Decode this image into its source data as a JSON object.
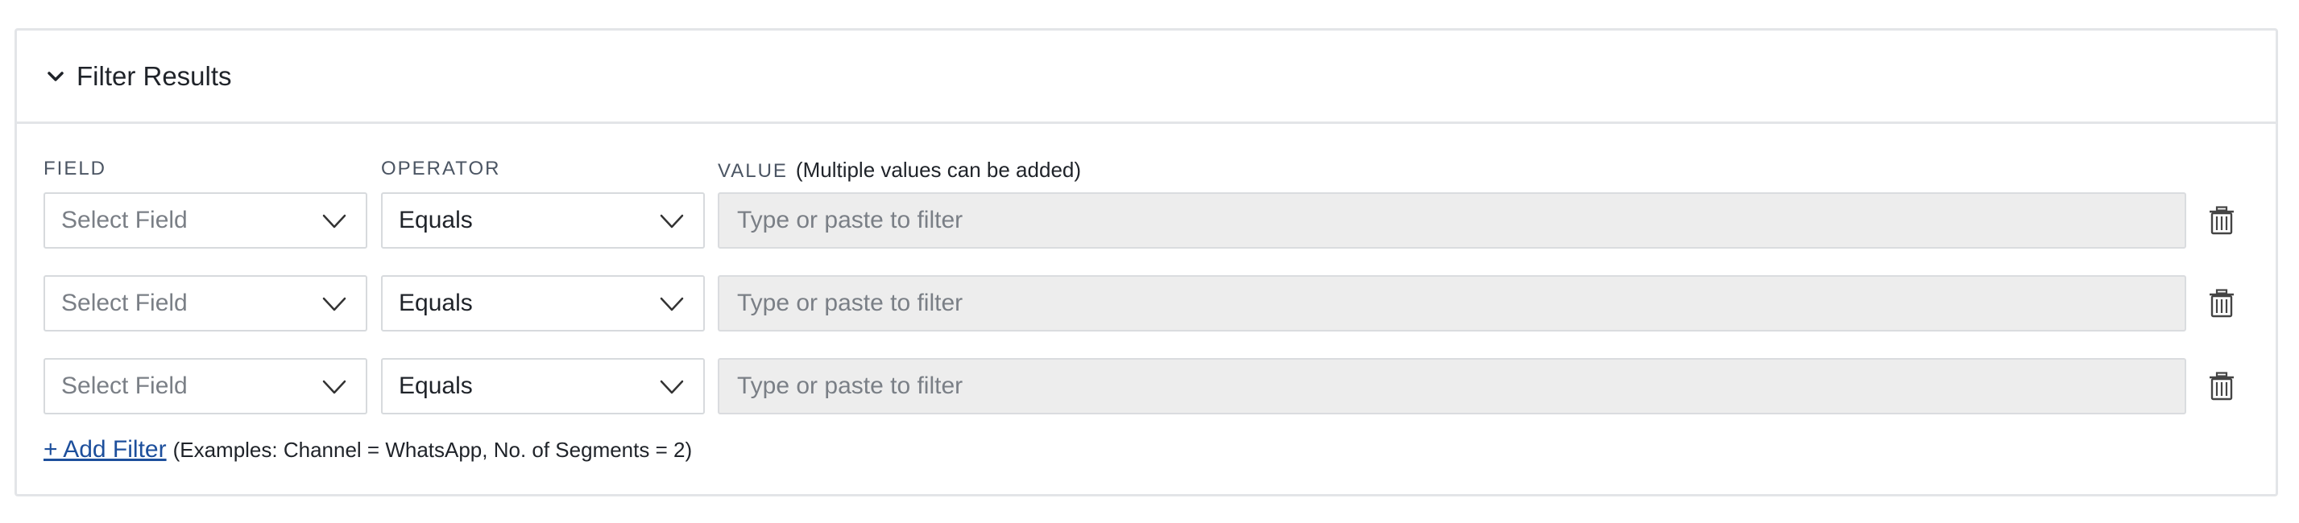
{
  "panel": {
    "title": "Filter Results",
    "icon": "chevron-down-icon"
  },
  "columns": {
    "field": "FIELD",
    "operator": "OPERATOR",
    "value": "VALUE",
    "value_hint": "(Multiple values can be added)"
  },
  "rows": [
    {
      "field": "Select Field",
      "operator": "Equals",
      "value_placeholder": "Type or paste to filter"
    },
    {
      "field": "Select Field",
      "operator": "Equals",
      "value_placeholder": "Type or paste to filter"
    },
    {
      "field": "Select Field",
      "operator": "Equals",
      "value_placeholder": "Type or paste to filter"
    }
  ],
  "footer": {
    "add_filter": "+ Add Filter",
    "examples": "(Examples: Channel = WhatsApp, No. of Segments = 2)"
  },
  "colors": {
    "border": "#e3e5e8",
    "value_bg": "#ededed",
    "link": "#1d4f9c"
  }
}
